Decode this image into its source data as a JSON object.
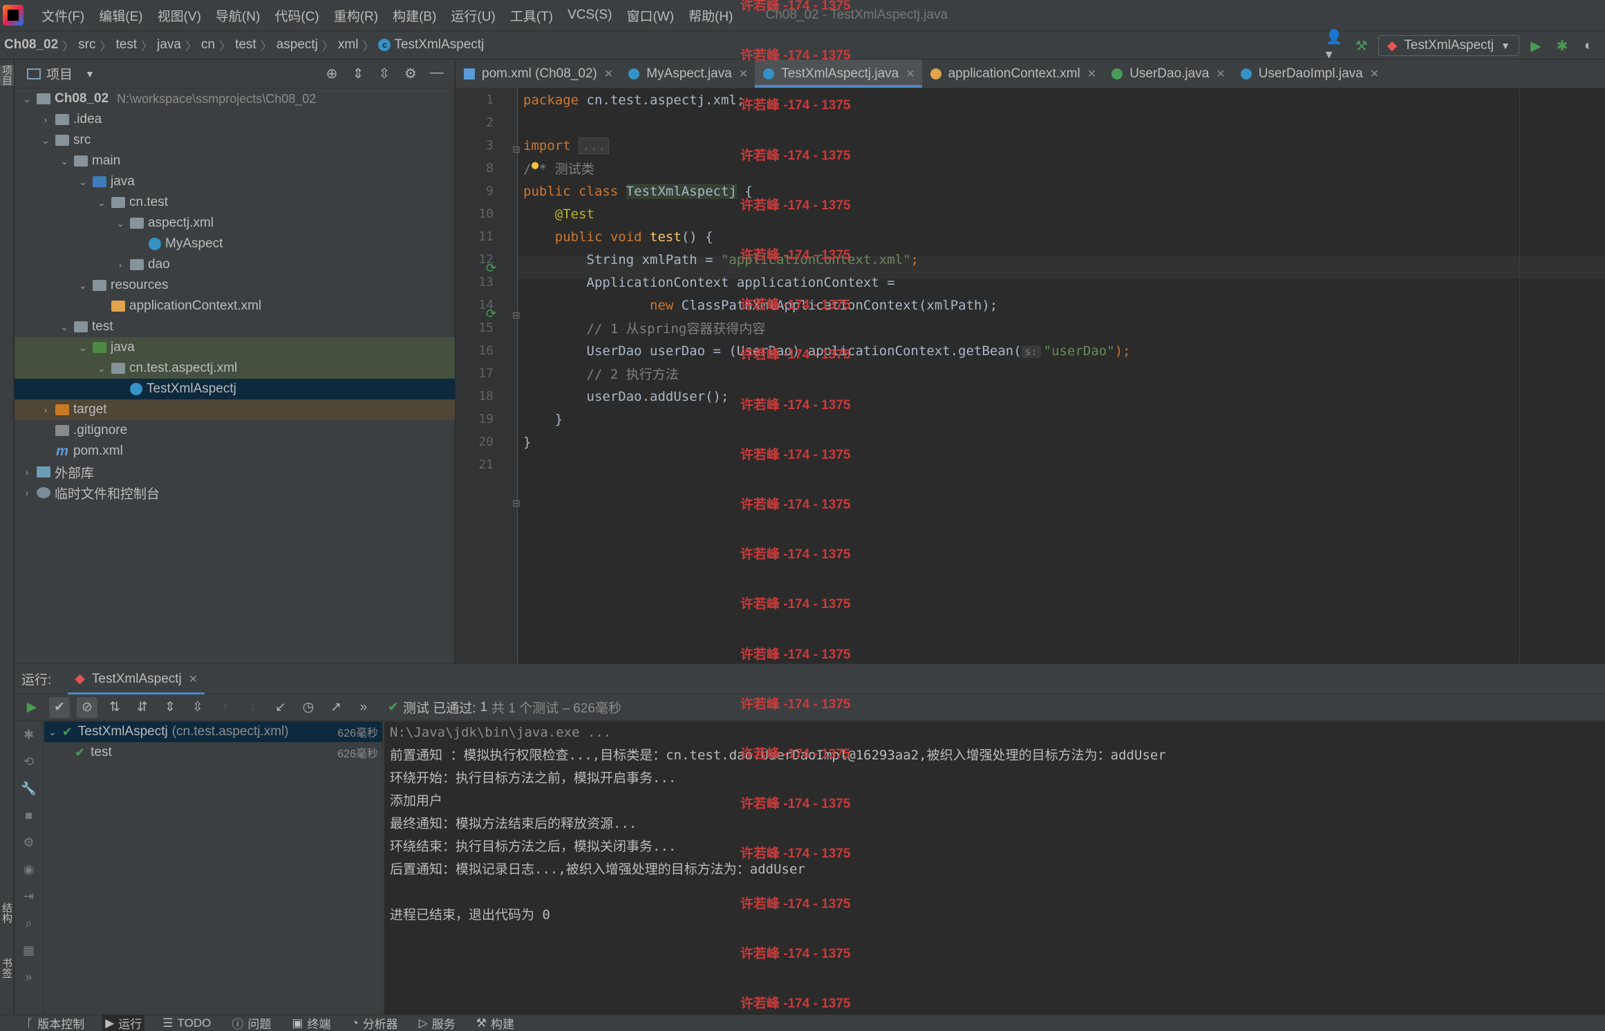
{
  "window_title": "Ch08_02 - TestXmlAspectj.java",
  "menu": [
    "文件(F)",
    "编辑(E)",
    "视图(V)",
    "导航(N)",
    "代码(C)",
    "重构(R)",
    "构建(B)",
    "运行(U)",
    "工具(T)",
    "VCS(S)",
    "窗口(W)",
    "帮助(H)"
  ],
  "breadcrumbs": [
    "Ch08_02",
    "src",
    "test",
    "java",
    "cn",
    "test",
    "aspectj",
    "xml",
    "TestXmlAspectj"
  ],
  "run_config": "TestXmlAspectj",
  "project_panel": {
    "title": "项目",
    "tree": [
      {
        "label": "Ch08_02",
        "extra": "N:\\workspace\\ssmprojects\\Ch08_02",
        "depth": 0,
        "expanded": true,
        "icon": "module-folder"
      },
      {
        "label": ".idea",
        "depth": 1,
        "expanded": false,
        "icon": "folder"
      },
      {
        "label": "src",
        "depth": 1,
        "expanded": true,
        "icon": "folder"
      },
      {
        "label": "main",
        "depth": 2,
        "expanded": true,
        "icon": "folder"
      },
      {
        "label": "java",
        "depth": 3,
        "expanded": true,
        "icon": "source-folder"
      },
      {
        "label": "cn.test",
        "depth": 4,
        "expanded": true,
        "icon": "package"
      },
      {
        "label": "aspectj.xml",
        "depth": 5,
        "expanded": true,
        "icon": "package"
      },
      {
        "label": "MyAspect",
        "depth": 6,
        "icon": "class"
      },
      {
        "label": "dao",
        "depth": 5,
        "expanded": false,
        "icon": "package"
      },
      {
        "label": "resources",
        "depth": 3,
        "expanded": true,
        "icon": "resources-folder"
      },
      {
        "label": "applicationContext.xml",
        "depth": 4,
        "icon": "xml"
      },
      {
        "label": "test",
        "depth": 2,
        "expanded": true,
        "icon": "folder"
      },
      {
        "label": "java",
        "depth": 3,
        "expanded": true,
        "icon": "test-folder"
      },
      {
        "label": "cn.test.aspectj.xml",
        "depth": 4,
        "expanded": true,
        "icon": "package"
      },
      {
        "label": "TestXmlAspectj",
        "depth": 5,
        "icon": "class"
      },
      {
        "label": "target",
        "depth": 1,
        "expanded": false,
        "icon": "excluded-folder"
      },
      {
        "label": ".gitignore",
        "depth": 1,
        "icon": "git"
      },
      {
        "label": "pom.xml",
        "depth": 1,
        "icon": "maven"
      },
      {
        "label": "外部库",
        "depth": 0,
        "expanded": false,
        "icon": "library"
      },
      {
        "label": "临时文件和控制台",
        "depth": 0,
        "expanded": false,
        "icon": "scratch"
      }
    ]
  },
  "tabs": [
    {
      "label": "pom.xml (Ch08_02)",
      "icon": "maven",
      "active": false
    },
    {
      "label": "MyAspect.java",
      "icon": "class",
      "active": false
    },
    {
      "label": "TestXmlAspectj.java",
      "icon": "class",
      "active": true
    },
    {
      "label": "applicationContext.xml",
      "icon": "xml",
      "active": false
    },
    {
      "label": "UserDao.java",
      "icon": "interface",
      "active": false
    },
    {
      "label": "UserDaoImpl.java",
      "icon": "class",
      "active": false
    }
  ],
  "code": {
    "line_numbers": [
      "1",
      "2",
      "3",
      "8",
      "9",
      "10",
      "11",
      "12",
      "13",
      "14",
      "15",
      "16",
      "17",
      "18",
      "19",
      "20",
      "21"
    ],
    "l1_kw": "package",
    "l1_rest": " cn.test.aspectj.xml;",
    "l3_kw": "import",
    "l3_fold": "...",
    "l8_cmt": "/** 测试类",
    "l9_kw": "public class ",
    "l9_cls": "TestXmlAspectj",
    "l9_rest": " {",
    "l10_ann": "@Test",
    "l11_kw": "public void ",
    "l11_fn": "test",
    "l11_rest": "() {",
    "l12_a": "String xmlPath = ",
    "l12_str": "\"applicationContext.xml\"",
    "l12_b": ";",
    "l13": "ApplicationContext applicationContext =",
    "l14_kw": "new ",
    "l14_rest": "ClassPathXmlApplicationContext(xmlPath);",
    "l15_cmt": "// 1 从spring容器获得内容",
    "l16_a": "UserDao userDao = (UserDao) applicationContext.getBean(",
    "l16_hint": "s:",
    "l16_str": "\"userDao\"",
    "l16_b": ");",
    "l17_cmt": "// 2 执行方法",
    "l18": "userDao.addUser();",
    "l19": "}",
    "l20": "}"
  },
  "watermark": "许若峰 -174 - 1375",
  "run_panel": {
    "label": "运行:",
    "tab": "TestXmlAspectj",
    "status_prefix": "测试 已通过:",
    "status_count": "1",
    "status_suffix": "共 1 个测试 – 626毫秒",
    "tests": [
      {
        "label": "TestXmlAspectj",
        "extra": "(cn.test.aspectj.xml)",
        "time": "626毫秒",
        "selected": true
      },
      {
        "label": "test",
        "extra": "",
        "time": "626毫秒",
        "selected": false
      }
    ],
    "console": [
      "N:\\Java\\jdk\\bin\\java.exe ...",
      "前置通知 ：模拟执行权限检查...,目标类是：cn.test.dao.UserDaoImpl@16293aa2,被织入增强处理的目标方法为：addUser",
      "环绕开始：执行目标方法之前，模拟开启事务...",
      "添加用户",
      "最终通知：模拟方法结束后的释放资源...",
      "环绕结束：执行目标方法之后，模拟关闭事务...",
      "后置通知：模拟记录日志...,被织入增强处理的目标方法为：addUser",
      "",
      "进程已结束，退出代码为 0"
    ]
  },
  "left_stripe": {
    "top": "项目",
    "middle": "结构",
    "bottom": "书签"
  },
  "bottom_bar": [
    "版本控制",
    "运行",
    "TODO",
    "问题",
    "终端",
    "分析器",
    "服务",
    "构建"
  ]
}
